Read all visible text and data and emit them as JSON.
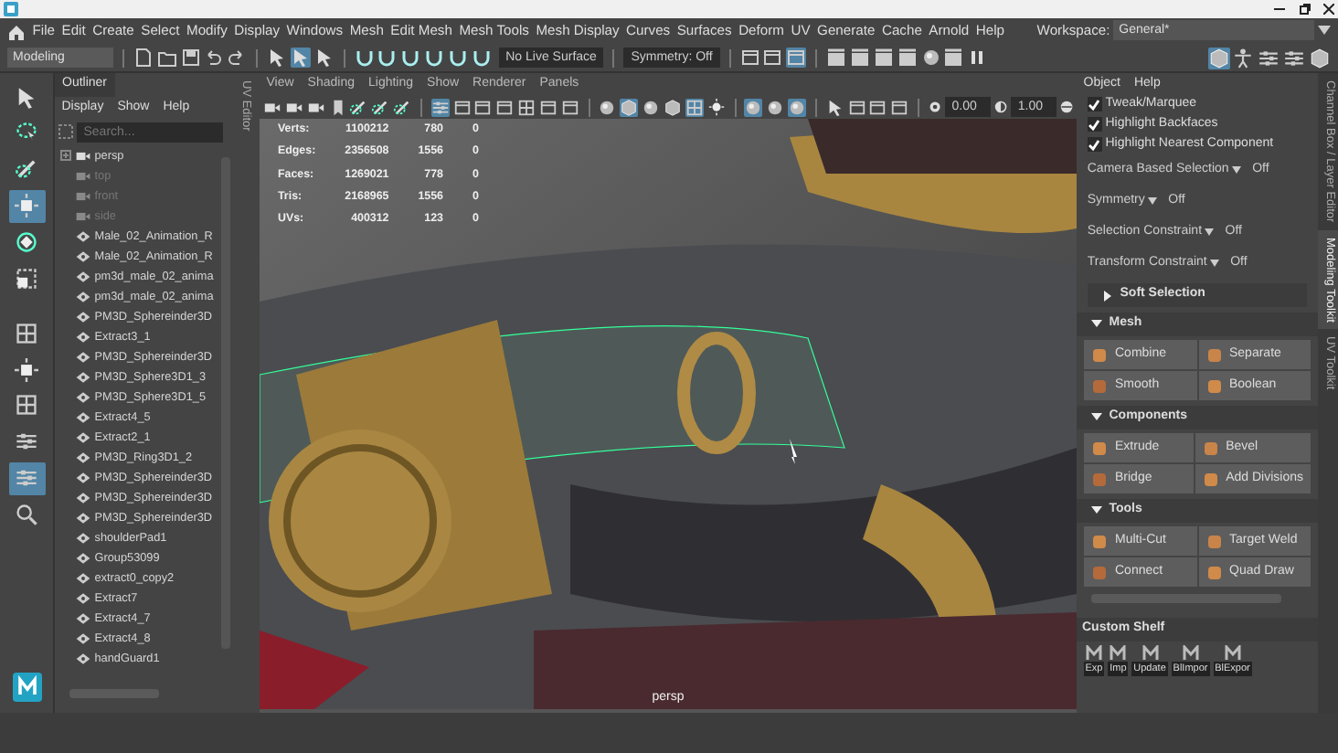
{
  "menu_bar": {
    "items": [
      "File",
      "Edit",
      "Create",
      "Select",
      "Modify",
      "Display",
      "Windows",
      "Mesh",
      "Edit Mesh",
      "Mesh Tools",
      "Mesh Display",
      "Curves",
      "Surfaces",
      "Deform",
      "UV",
      "Generate",
      "Cache",
      "Arnold",
      "Help"
    ],
    "workspace_label": "Workspace:",
    "workspace_value": "General*"
  },
  "status_line": {
    "mode": "Modeling",
    "live_surface": "No Live Surface",
    "symmetry": "Symmetry: Off",
    "icons_left": [
      {
        "kind": "file",
        "selected": false
      },
      {
        "kind": "folder",
        "selected": false
      },
      {
        "kind": "save",
        "selected": false
      },
      {
        "kind": "undo",
        "selected": false
      },
      {
        "kind": "redo",
        "selected": false
      },
      {
        "kind": "cursor",
        "selected": false
      },
      {
        "kind": "cursor",
        "selected": true
      },
      {
        "kind": "cursor",
        "selected": false
      },
      {
        "kind": "magnet",
        "selected": false
      },
      {
        "kind": "magnet",
        "selected": false
      },
      {
        "kind": "magnet",
        "selected": false
      },
      {
        "kind": "magnet",
        "selected": false
      },
      {
        "kind": "magnet",
        "selected": false
      },
      {
        "kind": "magnet",
        "selected": false
      }
    ],
    "icons_right": [
      {
        "kind": "window",
        "selected": false
      },
      {
        "kind": "window",
        "selected": false
      },
      {
        "kind": "window",
        "selected": true
      },
      {
        "kind": "clapper",
        "selected": false
      },
      {
        "kind": "clapper",
        "selected": false
      },
      {
        "kind": "clapper",
        "selected": false
      },
      {
        "kind": "clapper",
        "selected": false
      },
      {
        "kind": "sphere",
        "selected": false
      },
      {
        "kind": "clapper",
        "selected": false
      },
      {
        "kind": "pause",
        "selected": false
      }
    ],
    "icons_far": [
      {
        "kind": "cube",
        "selected": true
      },
      {
        "kind": "person",
        "selected": false
      },
      {
        "kind": "sliders",
        "selected": false
      },
      {
        "kind": "sliders",
        "selected": false
      },
      {
        "kind": "cube",
        "selected": false
      }
    ]
  },
  "toolbox": [
    {
      "kind": "cursor",
      "selected": false
    },
    {
      "kind": "lasso",
      "selected": false
    },
    {
      "kind": "brush",
      "selected": false
    },
    {
      "kind": "move",
      "selected": true
    },
    {
      "kind": "rotate",
      "selected": false
    },
    {
      "kind": "scale",
      "selected": false
    },
    {
      "kind": "grid",
      "selected": false
    },
    {
      "kind": "move",
      "selected": false
    },
    {
      "kind": "grid",
      "selected": false
    },
    {
      "kind": "sliders",
      "selected": false
    },
    {
      "kind": "sliders",
      "selected": true
    },
    {
      "kind": "search",
      "selected": false
    }
  ],
  "outliner": {
    "title": "Outliner",
    "menu": [
      "Display",
      "Show",
      "Help"
    ],
    "search_placeholder": "Search...",
    "items": [
      {
        "label": "persp",
        "kind": "camera",
        "dimmed": false
      },
      {
        "label": "top",
        "kind": "camera",
        "dimmed": true
      },
      {
        "label": "front",
        "kind": "camera",
        "dimmed": true
      },
      {
        "label": "side",
        "kind": "camera",
        "dimmed": true
      },
      {
        "label": "Male_02_Animation_R",
        "kind": "mesh",
        "dimmed": false
      },
      {
        "label": "Male_02_Animation_R",
        "kind": "mesh",
        "dimmed": false
      },
      {
        "label": "pm3d_male_02_anima",
        "kind": "mesh",
        "dimmed": false
      },
      {
        "label": "pm3d_male_02_anima",
        "kind": "mesh",
        "dimmed": false
      },
      {
        "label": "PM3D_Sphereinder3D",
        "kind": "mesh",
        "dimmed": false
      },
      {
        "label": "Extract3_1",
        "kind": "mesh",
        "dimmed": false
      },
      {
        "label": "PM3D_Sphereinder3D",
        "kind": "mesh",
        "dimmed": false
      },
      {
        "label": "PM3D_Sphere3D1_3",
        "kind": "mesh",
        "dimmed": false
      },
      {
        "label": "PM3D_Sphere3D1_5",
        "kind": "mesh",
        "dimmed": false
      },
      {
        "label": "Extract4_5",
        "kind": "mesh",
        "dimmed": false
      },
      {
        "label": "Extract2_1",
        "kind": "mesh",
        "dimmed": false
      },
      {
        "label": "PM3D_Ring3D1_2",
        "kind": "mesh",
        "dimmed": false
      },
      {
        "label": "PM3D_Sphereinder3D",
        "kind": "mesh",
        "dimmed": false
      },
      {
        "label": "PM3D_Sphereinder3D",
        "kind": "mesh",
        "dimmed": false
      },
      {
        "label": "PM3D_Sphereinder3D",
        "kind": "mesh",
        "dimmed": false
      },
      {
        "label": "shoulderPad1",
        "kind": "mesh",
        "dimmed": false
      },
      {
        "label": "Group53099",
        "kind": "mesh",
        "dimmed": false
      },
      {
        "label": "extract0_copy2",
        "kind": "mesh",
        "dimmed": false
      },
      {
        "label": "Extract7",
        "kind": "mesh",
        "dimmed": false
      },
      {
        "label": "Extract4_7",
        "kind": "mesh",
        "dimmed": false
      },
      {
        "label": "Extract4_8",
        "kind": "mesh",
        "dimmed": false
      },
      {
        "label": "handGuard1",
        "kind": "mesh",
        "dimmed": false
      }
    ]
  },
  "uv_editor_tab": "UV Editor",
  "viewport": {
    "menu": [
      "View",
      "Shading",
      "Lighting",
      "Show",
      "Renderer",
      "Panels"
    ],
    "icons": [
      {
        "kind": "camera",
        "selected": false
      },
      {
        "kind": "camera",
        "selected": false
      },
      {
        "kind": "camera",
        "selected": false
      },
      {
        "kind": "bookmark",
        "selected": false
      },
      {
        "kind": "brush",
        "selected": false
      },
      {
        "kind": "brush",
        "selected": false
      },
      {
        "kind": "brush",
        "selected": false
      },
      {
        "kind": "sliders",
        "selected": true
      },
      {
        "kind": "window",
        "selected": false
      },
      {
        "kind": "window",
        "selected": false
      },
      {
        "kind": "window",
        "selected": false
      },
      {
        "kind": "grid",
        "selected": false
      },
      {
        "kind": "window",
        "selected": false
      },
      {
        "kind": "window",
        "selected": false
      },
      {
        "kind": "sphere",
        "selected": false
      },
      {
        "kind": "cube",
        "selected": true
      },
      {
        "kind": "sphere",
        "selected": false
      },
      {
        "kind": "cube",
        "selected": false
      },
      {
        "kind": "grid",
        "selected": true
      },
      {
        "kind": "light",
        "selected": false
      },
      {
        "kind": "sphere",
        "selected": true
      },
      {
        "kind": "sphere",
        "selected": false
      },
      {
        "kind": "sphere",
        "selected": true
      },
      {
        "kind": "cursor",
        "selected": false
      },
      {
        "kind": "window",
        "selected": false
      },
      {
        "kind": "window",
        "selected": false
      },
      {
        "kind": "window",
        "selected": false
      }
    ],
    "exposure": "0.00",
    "gamma": "1.00",
    "stats": [
      {
        "label": "Verts:",
        "values": [
          "1100212",
          "780",
          "0"
        ]
      },
      {
        "label": "Edges:",
        "values": [
          "2356508",
          "1556",
          "0"
        ]
      },
      {
        "label": "Faces:",
        "values": [
          "1269021",
          "778",
          "0"
        ]
      },
      {
        "label": "Tris:",
        "values": [
          "2168965",
          "1556",
          "0"
        ]
      },
      {
        "label": "UVs:",
        "values": [
          "400312",
          "123",
          "0"
        ]
      }
    ],
    "camera_label": "persp"
  },
  "toolkit": {
    "menu": [
      "Object",
      "Help"
    ],
    "checks": [
      {
        "label": "Tweak/Marquee",
        "checked": true
      },
      {
        "label": "Highlight Backfaces",
        "checked": true
      },
      {
        "label": "Highlight Nearest Component",
        "checked": true
      }
    ],
    "options": [
      {
        "label": "Camera Based Selection",
        "value": "Off"
      },
      {
        "label": "Symmetry",
        "value": "Off"
      },
      {
        "label": "Selection Constraint",
        "value": "Off"
      },
      {
        "label": "Transform Constraint",
        "value": "Off"
      }
    ],
    "sections": [
      {
        "title": "Soft Selection",
        "expanded": false
      },
      {
        "title": "Mesh",
        "expanded": true,
        "buttons": [
          "Combine",
          "Separate",
          "Smooth",
          "Boolean"
        ]
      },
      {
        "title": "Components",
        "expanded": true,
        "buttons": [
          "Extrude",
          "Bevel",
          "Bridge",
          "Add Divisions"
        ]
      },
      {
        "title": "Tools",
        "expanded": true,
        "buttons": [
          "Multi-Cut",
          "Target Weld",
          "Connect",
          "Quad Draw"
        ]
      }
    ],
    "shelf_title": "Custom Shelf",
    "shelf_items": [
      "Exp",
      "Imp",
      "Update",
      "BlImpor",
      "BlExpor"
    ]
  },
  "side_tabs": [
    {
      "label": "Channel Box / Layer Editor",
      "selected": false
    },
    {
      "label": "Modeling Toolkit",
      "selected": true
    },
    {
      "label": "UV Toolkit",
      "selected": false
    }
  ]
}
